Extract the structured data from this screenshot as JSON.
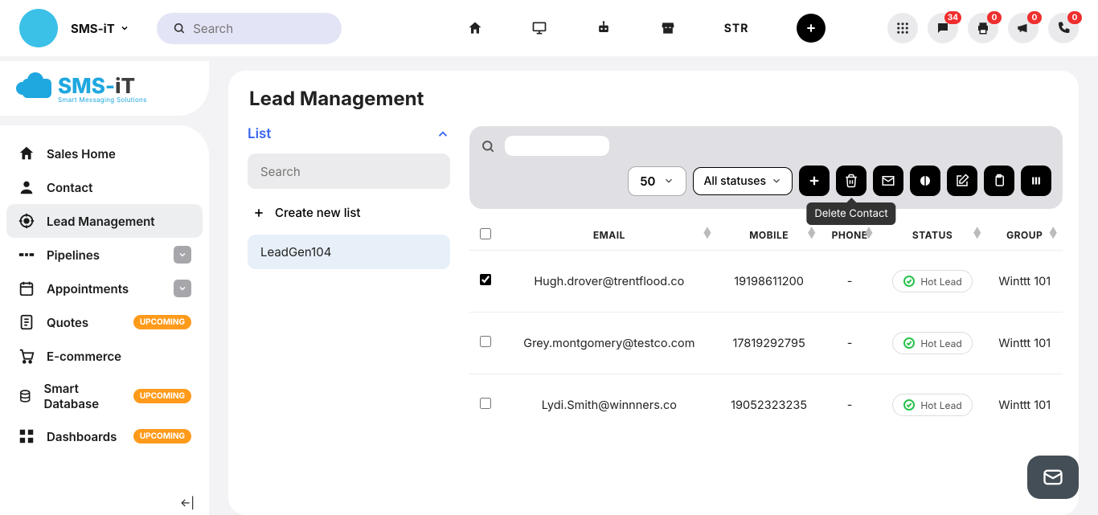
{
  "header": {
    "brand": "SMS-iT",
    "search_placeholder": "Search",
    "nav": {
      "str": "STR"
    },
    "badges": {
      "chat": "34",
      "print": "0",
      "announce": "0",
      "phone": "0"
    }
  },
  "logo": {
    "sms": "SMS",
    "dash": "-",
    "it": "iT",
    "sub": "Smart Messaging Solutions"
  },
  "sidebar": {
    "items": [
      {
        "label": "Sales Home",
        "icon": "home",
        "active": false,
        "expand": null,
        "badge": null
      },
      {
        "label": "Contact",
        "icon": "user",
        "active": false,
        "expand": null,
        "badge": null
      },
      {
        "label": "Lead Management",
        "icon": "target",
        "active": true,
        "expand": null,
        "badge": null
      },
      {
        "label": "Pipelines",
        "icon": "pipe",
        "active": false,
        "expand": true,
        "badge": null
      },
      {
        "label": "Appointments",
        "icon": "calendar",
        "active": false,
        "expand": true,
        "badge": null
      },
      {
        "label": "Quotes",
        "icon": "quote",
        "active": false,
        "expand": null,
        "badge": "UPCOMING"
      },
      {
        "label": "E-commerce",
        "icon": "cart",
        "active": false,
        "expand": null,
        "badge": null
      },
      {
        "label": "Smart Database",
        "icon": "db",
        "active": false,
        "expand": null,
        "badge": "UPCOMING"
      },
      {
        "label": "Dashboards",
        "icon": "dash",
        "active": false,
        "expand": null,
        "badge": "UPCOMING"
      }
    ]
  },
  "content": {
    "title": "Lead Management",
    "list": {
      "header": "List",
      "search_placeholder": "Search",
      "create": "Create new list",
      "items": [
        "LeadGen104"
      ]
    },
    "toolbar": {
      "page_size": "50",
      "status_filter": "All statuses",
      "delete_tooltip": "Delete Contact"
    },
    "table": {
      "headers": {
        "email": "EMAIL",
        "mobile": "MOBILE",
        "phone": "PHONE",
        "status": "STATUS",
        "group": "GROUP"
      },
      "rows": [
        {
          "checked": true,
          "email": "Hugh.drover@trentflood.co",
          "mobile": "19198611200",
          "phone": "-",
          "status": "Hot Lead",
          "group": "Winttt 101"
        },
        {
          "checked": false,
          "email": "Grey.montgomery@testco.com",
          "mobile": "17819292795",
          "phone": "-",
          "status": "Hot Lead",
          "group": "Winttt 101"
        },
        {
          "checked": false,
          "email": "Lydi.Smith@winnners.co",
          "mobile": "19052323235",
          "phone": "-",
          "status": "Hot Lead",
          "group": "Winttt 101"
        }
      ]
    }
  }
}
